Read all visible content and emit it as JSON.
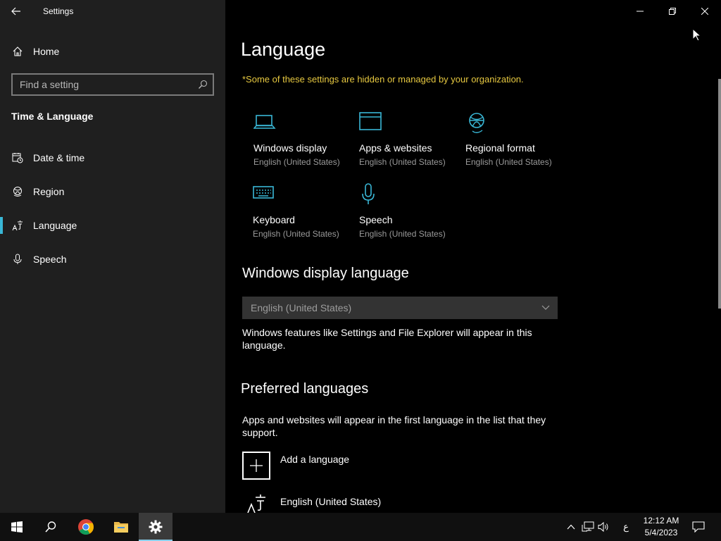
{
  "window": {
    "title": "Settings",
    "back_icon": "back-arrow-icon",
    "minimize_icon": "minimize-icon",
    "restore_icon": "restore-icon",
    "close_icon": "close-icon"
  },
  "sidebar": {
    "home_label": "Home",
    "search_placeholder": "Find a setting",
    "section_title": "Time & Language",
    "items": [
      {
        "label": "Date & time",
        "icon": "calendar-clock-icon"
      },
      {
        "label": "Region",
        "icon": "globe-icon"
      },
      {
        "label": "Language",
        "icon": "language-icon",
        "active": true
      },
      {
        "label": "Speech",
        "icon": "microphone-icon"
      }
    ]
  },
  "main": {
    "title": "Language",
    "managed_note": "*Some of these settings are hidden or managed by your organization.",
    "tiles": [
      {
        "title": "Windows display",
        "subtitle": "English (United States)",
        "icon": "laptop-icon"
      },
      {
        "title": "Apps & websites",
        "subtitle": "English (United States)",
        "icon": "browser-window-icon"
      },
      {
        "title": "Regional format",
        "subtitle": "English (United States)",
        "icon": "globe-icon"
      },
      {
        "title": "Keyboard",
        "subtitle": "English (United States)",
        "icon": "keyboard-icon"
      },
      {
        "title": "Speech",
        "subtitle": "English (United States)",
        "icon": "microphone-icon"
      }
    ],
    "display_language": {
      "heading": "Windows display language",
      "selected": "English (United States)",
      "description": "Windows features like Settings and File Explorer will appear in this language."
    },
    "preferred": {
      "heading": "Preferred languages",
      "description": "Apps and websites will appear in the first language in the list that they support.",
      "add_label": "Add a language",
      "languages": [
        "English (United States)"
      ]
    }
  },
  "taskbar": {
    "time": "12:12 AM",
    "date": "5/4/2023",
    "ime_indicator": "ع",
    "accent": "#39b7d6"
  }
}
